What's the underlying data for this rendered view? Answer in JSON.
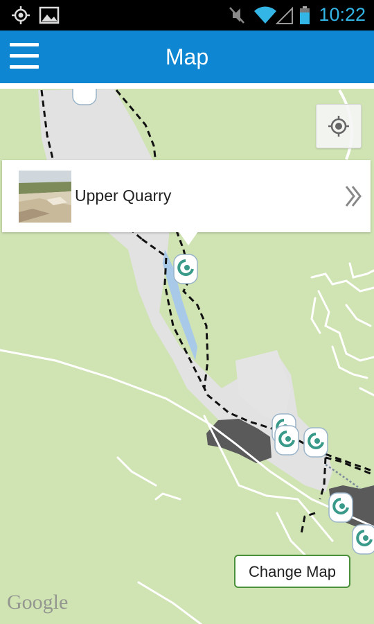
{
  "status_bar": {
    "time": "10:22",
    "icons": [
      "location-icon",
      "image-icon",
      "mute-icon",
      "wifi-icon",
      "signal-icon",
      "battery-icon"
    ]
  },
  "app_bar": {
    "title": "Map",
    "menu_icon": "hamburger-menu-icon"
  },
  "map": {
    "info_window": {
      "place_name": "Upper Quarry",
      "thumbnail": "quarry-photo",
      "chevron_icon": "double-chevron-right-icon"
    },
    "locate_icon": "my-location-icon",
    "change_map_label": "Change Map",
    "attribution": "Google",
    "marker_icon": "trail-marker-icon",
    "colors": {
      "land": "#cfe3b3",
      "trail": "#111111",
      "roads": "#ffffff",
      "urban": "#e2e2e2",
      "water": "#a9c9e8",
      "quarry_pit": "#5a5a5a",
      "app_bar": "#0f86d2",
      "status_text": "#33b5e5"
    }
  }
}
